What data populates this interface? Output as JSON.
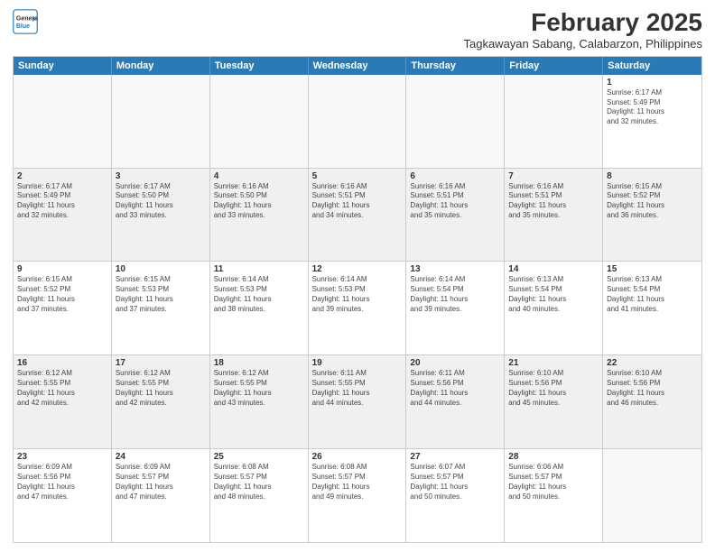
{
  "header": {
    "logo_line1": "General",
    "logo_line2": "Blue",
    "main_title": "February 2025",
    "sub_title": "Tagkawayan Sabang, Calabarzon, Philippines"
  },
  "weekdays": [
    "Sunday",
    "Monday",
    "Tuesday",
    "Wednesday",
    "Thursday",
    "Friday",
    "Saturday"
  ],
  "rows": [
    {
      "cells": [
        {
          "day": "",
          "info": ""
        },
        {
          "day": "",
          "info": ""
        },
        {
          "day": "",
          "info": ""
        },
        {
          "day": "",
          "info": ""
        },
        {
          "day": "",
          "info": ""
        },
        {
          "day": "",
          "info": ""
        },
        {
          "day": "1",
          "info": "Sunrise: 6:17 AM\nSunset: 5:49 PM\nDaylight: 11 hours\nand 32 minutes."
        }
      ]
    },
    {
      "cells": [
        {
          "day": "2",
          "info": "Sunrise: 6:17 AM\nSunset: 5:49 PM\nDaylight: 11 hours\nand 32 minutes."
        },
        {
          "day": "3",
          "info": "Sunrise: 6:17 AM\nSunset: 5:50 PM\nDaylight: 11 hours\nand 33 minutes."
        },
        {
          "day": "4",
          "info": "Sunrise: 6:16 AM\nSunset: 5:50 PM\nDaylight: 11 hours\nand 33 minutes."
        },
        {
          "day": "5",
          "info": "Sunrise: 6:16 AM\nSunset: 5:51 PM\nDaylight: 11 hours\nand 34 minutes."
        },
        {
          "day": "6",
          "info": "Sunrise: 6:16 AM\nSunset: 5:51 PM\nDaylight: 11 hours\nand 35 minutes."
        },
        {
          "day": "7",
          "info": "Sunrise: 6:16 AM\nSunset: 5:51 PM\nDaylight: 11 hours\nand 35 minutes."
        },
        {
          "day": "8",
          "info": "Sunrise: 6:15 AM\nSunset: 5:52 PM\nDaylight: 11 hours\nand 36 minutes."
        }
      ]
    },
    {
      "cells": [
        {
          "day": "9",
          "info": "Sunrise: 6:15 AM\nSunset: 5:52 PM\nDaylight: 11 hours\nand 37 minutes."
        },
        {
          "day": "10",
          "info": "Sunrise: 6:15 AM\nSunset: 5:53 PM\nDaylight: 11 hours\nand 37 minutes."
        },
        {
          "day": "11",
          "info": "Sunrise: 6:14 AM\nSunset: 5:53 PM\nDaylight: 11 hours\nand 38 minutes."
        },
        {
          "day": "12",
          "info": "Sunrise: 6:14 AM\nSunset: 5:53 PM\nDaylight: 11 hours\nand 39 minutes."
        },
        {
          "day": "13",
          "info": "Sunrise: 6:14 AM\nSunset: 5:54 PM\nDaylight: 11 hours\nand 39 minutes."
        },
        {
          "day": "14",
          "info": "Sunrise: 6:13 AM\nSunset: 5:54 PM\nDaylight: 11 hours\nand 40 minutes."
        },
        {
          "day": "15",
          "info": "Sunrise: 6:13 AM\nSunset: 5:54 PM\nDaylight: 11 hours\nand 41 minutes."
        }
      ]
    },
    {
      "cells": [
        {
          "day": "16",
          "info": "Sunrise: 6:12 AM\nSunset: 5:55 PM\nDaylight: 11 hours\nand 42 minutes."
        },
        {
          "day": "17",
          "info": "Sunrise: 6:12 AM\nSunset: 5:55 PM\nDaylight: 11 hours\nand 42 minutes."
        },
        {
          "day": "18",
          "info": "Sunrise: 6:12 AM\nSunset: 5:55 PM\nDaylight: 11 hours\nand 43 minutes."
        },
        {
          "day": "19",
          "info": "Sunrise: 6:11 AM\nSunset: 5:55 PM\nDaylight: 11 hours\nand 44 minutes."
        },
        {
          "day": "20",
          "info": "Sunrise: 6:11 AM\nSunset: 5:56 PM\nDaylight: 11 hours\nand 44 minutes."
        },
        {
          "day": "21",
          "info": "Sunrise: 6:10 AM\nSunset: 5:56 PM\nDaylight: 11 hours\nand 45 minutes."
        },
        {
          "day": "22",
          "info": "Sunrise: 6:10 AM\nSunset: 5:56 PM\nDaylight: 11 hours\nand 46 minutes."
        }
      ]
    },
    {
      "cells": [
        {
          "day": "23",
          "info": "Sunrise: 6:09 AM\nSunset: 5:56 PM\nDaylight: 11 hours\nand 47 minutes."
        },
        {
          "day": "24",
          "info": "Sunrise: 6:09 AM\nSunset: 5:57 PM\nDaylight: 11 hours\nand 47 minutes."
        },
        {
          "day": "25",
          "info": "Sunrise: 6:08 AM\nSunset: 5:57 PM\nDaylight: 11 hours\nand 48 minutes."
        },
        {
          "day": "26",
          "info": "Sunrise: 6:08 AM\nSunset: 5:57 PM\nDaylight: 11 hours\nand 49 minutes."
        },
        {
          "day": "27",
          "info": "Sunrise: 6:07 AM\nSunset: 5:57 PM\nDaylight: 11 hours\nand 50 minutes."
        },
        {
          "day": "28",
          "info": "Sunrise: 6:06 AM\nSunset: 5:57 PM\nDaylight: 11 hours\nand 50 minutes."
        },
        {
          "day": "",
          "info": ""
        }
      ]
    }
  ]
}
